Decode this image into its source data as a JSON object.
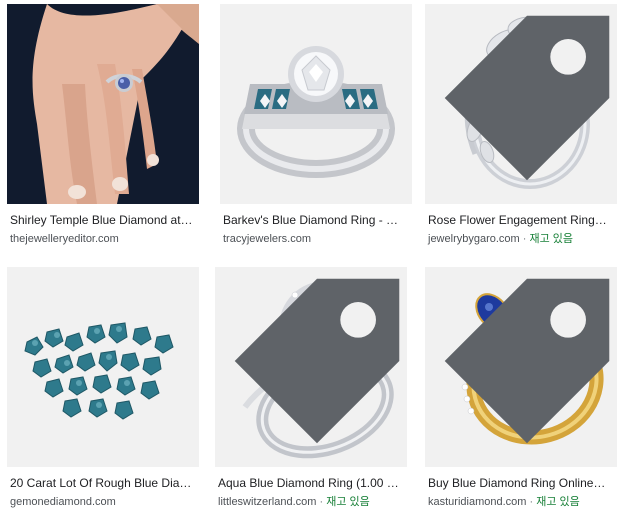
{
  "colors": {
    "caption_text": "#202124",
    "source_text": "#4d5156",
    "in_stock": "#188038",
    "thumb_bg": "#f1f1f1"
  },
  "results": [
    {
      "title": "Shirley Temple Blue Diamond at…",
      "source": "thejewelleryeditor.com",
      "stock": "",
      "has_product_tag": false,
      "image_icon": "hand-with-ring-icon"
    },
    {
      "title": "Barkev's Blue Diamond Ring - …",
      "source": "tracyjewelers.com",
      "stock": "",
      "has_product_tag": false,
      "image_icon": "blue-diamond-band-ring-icon"
    },
    {
      "title": "Rose Flower Engagement Ring…",
      "source": "jewelrybygaro.com",
      "stock": "재고 있음",
      "has_product_tag": true,
      "image_icon": "rose-flower-ring-icon"
    },
    {
      "title": "20 Carat Lot Of Rough Blue Dia…",
      "source": "gemonediamond.com",
      "stock": "",
      "has_product_tag": false,
      "image_icon": "rough-blue-diamonds-icon"
    },
    {
      "title": "Aqua Blue Diamond Ring (1.00 …",
      "source": "littleswitzerland.com",
      "stock": "재고 있음",
      "has_product_tag": true,
      "image_icon": "aqua-halo-ring-icon"
    },
    {
      "title": "Buy Blue Diamond Ring Online…",
      "source": "kasturidiamond.com",
      "stock": "재고 있음",
      "has_product_tag": true,
      "image_icon": "sapphire-flower-gold-ring-icon"
    }
  ]
}
